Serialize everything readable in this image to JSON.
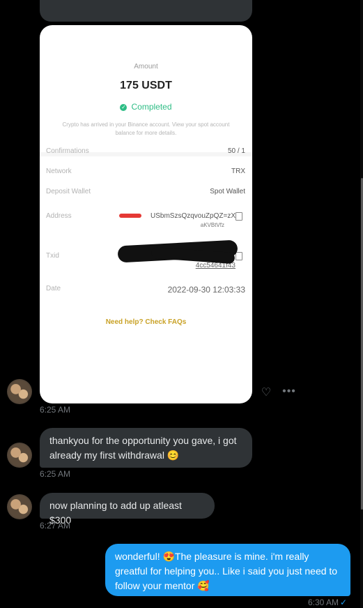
{
  "image_card": {
    "amount_label": "Amount",
    "amount_value": "175 USDT",
    "status": "Completed",
    "status_note": "Crypto has arrived in your Binance account. View your spot account balance for more details.",
    "rows": [
      {
        "label": "Confirmations",
        "value": "50 / 1"
      },
      {
        "label": "Network",
        "value": "TRX"
      },
      {
        "label": "Deposit Wallet",
        "value": "Spot Wallet"
      },
      {
        "label": "Address",
        "value": "USbmSzsQzqvouZpQZ=zX",
        "value2": "aKVBtVfz"
      },
      {
        "label": "Txid",
        "value": "4cc54641f43"
      },
      {
        "label": "Date",
        "value": "2022-09-30 12:03:33"
      }
    ],
    "help_link": "Need help? Check FAQs"
  },
  "messages": [
    {
      "time": "6:25 AM"
    },
    {
      "text": "thankyou for the opportunity you gave, i got already my first withdrawal 😊",
      "time": "6:25 AM"
    },
    {
      "text": "now planning to add up atleast $300",
      "time": "6:27 AM"
    },
    {
      "text": "wonderful! 😍The pleasure is mine. i'm really greatful for helping you.. Like i said you just need to follow your mentor 🥰",
      "time": "6:30 AM",
      "status_icon": "✓"
    }
  ],
  "icons": {
    "react": "♡",
    "more": "•••"
  },
  "colors": {
    "accent": "#1d9bf0",
    "incoming_bubble": "#2f3336",
    "background": "#000000"
  }
}
